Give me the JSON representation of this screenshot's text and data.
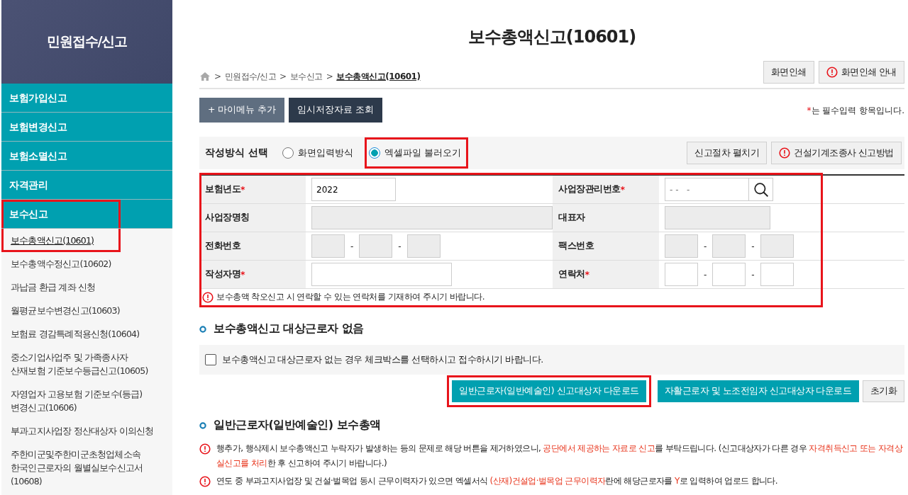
{
  "sidebar": {
    "title": "민원접수/신고",
    "items": [
      {
        "label": "보험가입신고",
        "kind": "main",
        "selected": false,
        "highlighted": false
      },
      {
        "label": "보험변경신고",
        "kind": "main",
        "selected": false,
        "highlighted": false
      },
      {
        "label": "보험소멸신고",
        "kind": "main",
        "selected": false,
        "highlighted": false
      },
      {
        "label": "자격관리",
        "kind": "main",
        "selected": false,
        "highlighted": false
      },
      {
        "label": "보수신고",
        "kind": "main",
        "selected": false,
        "highlighted": true
      },
      {
        "label": "보수총액신고(10601)",
        "kind": "sub",
        "selected": true,
        "highlighted": true
      },
      {
        "label": "보수총액수정신고(10602)",
        "kind": "sub",
        "selected": false,
        "highlighted": false
      },
      {
        "label": "과납금 환급 계좌 신청",
        "kind": "sub",
        "selected": false,
        "highlighted": false
      },
      {
        "label": "월평균보수변경신고(10603)",
        "kind": "sub",
        "selected": false,
        "highlighted": false
      },
      {
        "label": "보험료 경감특례적용신청(10604)",
        "kind": "sub",
        "selected": false,
        "highlighted": false
      },
      {
        "label": "중소기업사업주 및 가족종사자\n산재보험 기준보수등급신고(10605)",
        "kind": "sub",
        "selected": false,
        "highlighted": false
      },
      {
        "label": "자영업자 고용보험 기준보수(등급)\n변경신고(10606)",
        "kind": "sub",
        "selected": false,
        "highlighted": false
      },
      {
        "label": "부과고지사업장 정산대상자 이의신청",
        "kind": "sub",
        "selected": false,
        "highlighted": false
      },
      {
        "label": "주한미군및주한미군초청업체소속\n한국인근로자의 월별실보수신고서\n(10608)",
        "kind": "sub",
        "selected": false,
        "highlighted": false
      }
    ]
  },
  "page_title": "보수총액신고(10601)",
  "breadcrumb": [
    {
      "separator": ">",
      "label": "민원접수/신고",
      "current": false
    },
    {
      "separator": ">",
      "label": "보수신고",
      "current": false
    },
    {
      "separator": ">",
      "label": "보수총액신고(10601)",
      "current": true
    }
  ],
  "print_buttons": [
    {
      "label": "화면인쇄",
      "alert": false
    },
    {
      "label": "화면인쇄 안내",
      "alert": true
    }
  ],
  "action_buttons": [
    {
      "label": "+ 마이메뉴 추가",
      "kind": "slate"
    },
    {
      "label": "임시저장자료 조회",
      "kind": "dark"
    }
  ],
  "required_note": {
    "mark": "*",
    "text": "는 필수입력 항목입니다."
  },
  "method": {
    "label": "작성방식 선택",
    "options": [
      {
        "label": "화면입력방식",
        "selected": false,
        "highlighted": false
      },
      {
        "label": "엑셀파일 불러오기",
        "selected": true,
        "highlighted": true
      }
    ],
    "buttons": [
      {
        "label": "신고절차 펼치기",
        "alert": false
      },
      {
        "label": "건설기계조종사 신고방법",
        "alert": true
      }
    ]
  },
  "form": {
    "highlighted": true,
    "rows": [
      [
        {
          "label": "보험년도",
          "required": true,
          "kind": "text",
          "value": "2022"
        },
        {
          "label": "사업장관리번호",
          "required": true,
          "kind": "search",
          "placeholder": "- -   -"
        }
      ],
      [
        {
          "label": "사업장명칭",
          "required": false,
          "kind": "disabled"
        },
        {
          "label": "대표자",
          "required": false,
          "kind": "disabled"
        }
      ],
      [
        {
          "label": "전화번호",
          "required": false,
          "kind": "phone",
          "disabled": true,
          "separator": "-"
        },
        {
          "label": "팩스번호",
          "required": false,
          "kind": "phone",
          "disabled": true,
          "separator": "-"
        }
      ],
      [
        {
          "label": "작성자명",
          "required": true,
          "kind": "wide"
        },
        {
          "label": "연락처",
          "required": true,
          "kind": "phone",
          "disabled": false,
          "separator": "-"
        }
      ]
    ],
    "note": "보수총액 착오신고 시 연락할 수 있는 연락처를 기재하여 주시기 바랍니다."
  },
  "no_workers": {
    "heading": "보수총액신고 대상근로자 없음",
    "checkbox": {
      "label": "보수총액신고 대상근로자 없는 경우 체크박스를 선택하시고 접수하시기 바랍니다.",
      "checked": false
    }
  },
  "download_buttons": [
    {
      "label": "일반근로자(일반예술인) 신고대상자 다운로드",
      "kind": "teal",
      "highlighted": true
    },
    {
      "label": "자활근로자 및 노조전임자 신고대상자 다운로드",
      "kind": "teal",
      "highlighted": false
    },
    {
      "label": "초기화",
      "kind": "plain",
      "highlighted": false
    }
  ],
  "general": {
    "heading": "일반근로자(일반예술인) 보수총액",
    "notices": [
      [
        {
          "text": "행추가, 행삭제시 보수총액신고 누락자가 발생하는 등의 문제로 해당 버튼을 제거하였으니, ",
          "emphasis": false
        },
        {
          "text": "공단에서 제공하는 자료로 신고",
          "emphasis": true
        },
        {
          "text": "를 부탁드립니다. (신고대상자가 다른 경우 ",
          "emphasis": false
        },
        {
          "text": "자격취득신고 또는 자격상실신고를 처리",
          "emphasis": true
        },
        {
          "text": "한 후 신고하여 주시기 바랍니다.)",
          "emphasis": false
        }
      ],
      [
        {
          "text": "연도 중 부과고지사업장 및 건설·벌목업 동시 근무이력자가 있으면 엑셀서식 ",
          "emphasis": false
        },
        {
          "text": "(산재)건설업·벌목업 근무이력자",
          "emphasis": true
        },
        {
          "text": "란에 해당근로자를 ",
          "emphasis": false
        },
        {
          "text": "Y",
          "emphasis": true
        },
        {
          "text": "로 입력하여 업로드 합니다.",
          "emphasis": false
        }
      ]
    ]
  }
}
